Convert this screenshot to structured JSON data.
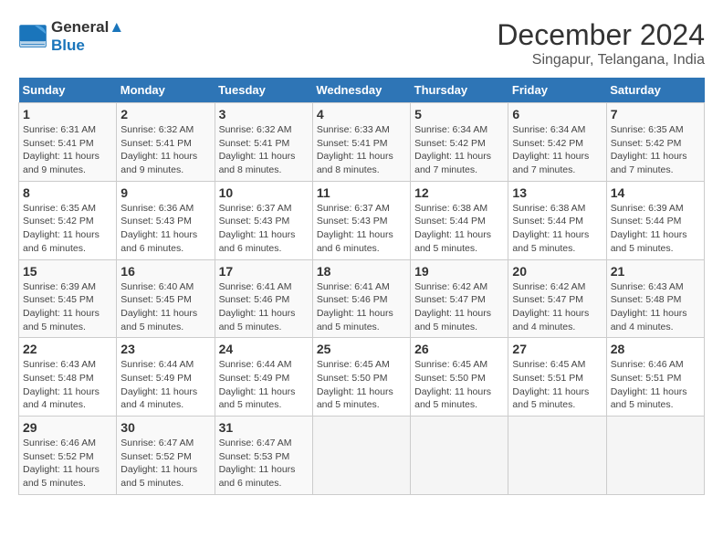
{
  "header": {
    "logo_line1": "General",
    "logo_line2": "Blue",
    "month": "December 2024",
    "location": "Singapur, Telangana, India"
  },
  "weekdays": [
    "Sunday",
    "Monday",
    "Tuesday",
    "Wednesday",
    "Thursday",
    "Friday",
    "Saturday"
  ],
  "weeks": [
    [
      {
        "day": "1",
        "sunrise": "6:31 AM",
        "sunset": "5:41 PM",
        "daylight": "11 hours and 9 minutes."
      },
      {
        "day": "2",
        "sunrise": "6:32 AM",
        "sunset": "5:41 PM",
        "daylight": "11 hours and 9 minutes."
      },
      {
        "day": "3",
        "sunrise": "6:32 AM",
        "sunset": "5:41 PM",
        "daylight": "11 hours and 8 minutes."
      },
      {
        "day": "4",
        "sunrise": "6:33 AM",
        "sunset": "5:41 PM",
        "daylight": "11 hours and 8 minutes."
      },
      {
        "day": "5",
        "sunrise": "6:34 AM",
        "sunset": "5:42 PM",
        "daylight": "11 hours and 7 minutes."
      },
      {
        "day": "6",
        "sunrise": "6:34 AM",
        "sunset": "5:42 PM",
        "daylight": "11 hours and 7 minutes."
      },
      {
        "day": "7",
        "sunrise": "6:35 AM",
        "sunset": "5:42 PM",
        "daylight": "11 hours and 7 minutes."
      }
    ],
    [
      {
        "day": "8",
        "sunrise": "6:35 AM",
        "sunset": "5:42 PM",
        "daylight": "11 hours and 6 minutes."
      },
      {
        "day": "9",
        "sunrise": "6:36 AM",
        "sunset": "5:43 PM",
        "daylight": "11 hours and 6 minutes."
      },
      {
        "day": "10",
        "sunrise": "6:37 AM",
        "sunset": "5:43 PM",
        "daylight": "11 hours and 6 minutes."
      },
      {
        "day": "11",
        "sunrise": "6:37 AM",
        "sunset": "5:43 PM",
        "daylight": "11 hours and 6 minutes."
      },
      {
        "day": "12",
        "sunrise": "6:38 AM",
        "sunset": "5:44 PM",
        "daylight": "11 hours and 5 minutes."
      },
      {
        "day": "13",
        "sunrise": "6:38 AM",
        "sunset": "5:44 PM",
        "daylight": "11 hours and 5 minutes."
      },
      {
        "day": "14",
        "sunrise": "6:39 AM",
        "sunset": "5:44 PM",
        "daylight": "11 hours and 5 minutes."
      }
    ],
    [
      {
        "day": "15",
        "sunrise": "6:39 AM",
        "sunset": "5:45 PM",
        "daylight": "11 hours and 5 minutes."
      },
      {
        "day": "16",
        "sunrise": "6:40 AM",
        "sunset": "5:45 PM",
        "daylight": "11 hours and 5 minutes."
      },
      {
        "day": "17",
        "sunrise": "6:41 AM",
        "sunset": "5:46 PM",
        "daylight": "11 hours and 5 minutes."
      },
      {
        "day": "18",
        "sunrise": "6:41 AM",
        "sunset": "5:46 PM",
        "daylight": "11 hours and 5 minutes."
      },
      {
        "day": "19",
        "sunrise": "6:42 AM",
        "sunset": "5:47 PM",
        "daylight": "11 hours and 5 minutes."
      },
      {
        "day": "20",
        "sunrise": "6:42 AM",
        "sunset": "5:47 PM",
        "daylight": "11 hours and 4 minutes."
      },
      {
        "day": "21",
        "sunrise": "6:43 AM",
        "sunset": "5:48 PM",
        "daylight": "11 hours and 4 minutes."
      }
    ],
    [
      {
        "day": "22",
        "sunrise": "6:43 AM",
        "sunset": "5:48 PM",
        "daylight": "11 hours and 4 minutes."
      },
      {
        "day": "23",
        "sunrise": "6:44 AM",
        "sunset": "5:49 PM",
        "daylight": "11 hours and 4 minutes."
      },
      {
        "day": "24",
        "sunrise": "6:44 AM",
        "sunset": "5:49 PM",
        "daylight": "11 hours and 5 minutes."
      },
      {
        "day": "25",
        "sunrise": "6:45 AM",
        "sunset": "5:50 PM",
        "daylight": "11 hours and 5 minutes."
      },
      {
        "day": "26",
        "sunrise": "6:45 AM",
        "sunset": "5:50 PM",
        "daylight": "11 hours and 5 minutes."
      },
      {
        "day": "27",
        "sunrise": "6:45 AM",
        "sunset": "5:51 PM",
        "daylight": "11 hours and 5 minutes."
      },
      {
        "day": "28",
        "sunrise": "6:46 AM",
        "sunset": "5:51 PM",
        "daylight": "11 hours and 5 minutes."
      }
    ],
    [
      {
        "day": "29",
        "sunrise": "6:46 AM",
        "sunset": "5:52 PM",
        "daylight": "11 hours and 5 minutes."
      },
      {
        "day": "30",
        "sunrise": "6:47 AM",
        "sunset": "5:52 PM",
        "daylight": "11 hours and 5 minutes."
      },
      {
        "day": "31",
        "sunrise": "6:47 AM",
        "sunset": "5:53 PM",
        "daylight": "11 hours and 6 minutes."
      },
      null,
      null,
      null,
      null
    ]
  ]
}
